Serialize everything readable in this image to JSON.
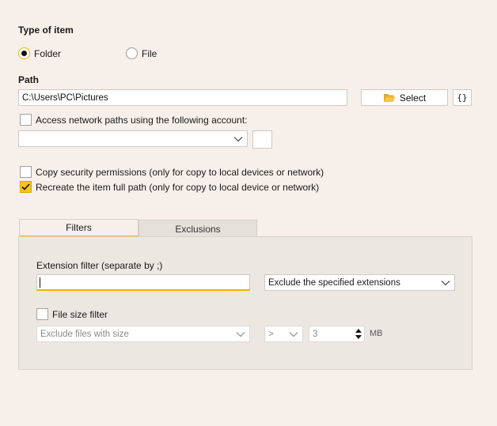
{
  "type_of_item": {
    "title": "Type of item",
    "options": [
      {
        "label": "Folder",
        "selected": true
      },
      {
        "label": "File",
        "selected": false
      }
    ]
  },
  "path": {
    "title": "Path",
    "value": "C:\\Users\\PC\\Pictures",
    "select_label": "Select",
    "variables_label": "{}"
  },
  "network": {
    "checkbox_label": "Access network paths using the following account:",
    "checked": false,
    "account_value": ""
  },
  "options": {
    "copy_security_label": "Copy security permissions (only for copy to local devices or network)",
    "copy_security_checked": false,
    "recreate_path_label": "Recreate the item full path (only for copy to local device or network)",
    "recreate_path_checked": true
  },
  "tabs": [
    {
      "label": "Filters",
      "active": true
    },
    {
      "label": "Exclusions",
      "active": false
    }
  ],
  "filters": {
    "extension_label": "Extension filter (separate by ;)",
    "extension_value": "",
    "extension_mode": "Exclude the specified extensions",
    "size_filter_label": "File size filter",
    "size_filter_checked": false,
    "size_mode": "Exclude files with size",
    "comparator": ">",
    "size_value": "3",
    "size_unit": "MB"
  },
  "colors": {
    "background": "#f7efe9",
    "accent": "#f0b400",
    "panel": "#ede7e2"
  }
}
